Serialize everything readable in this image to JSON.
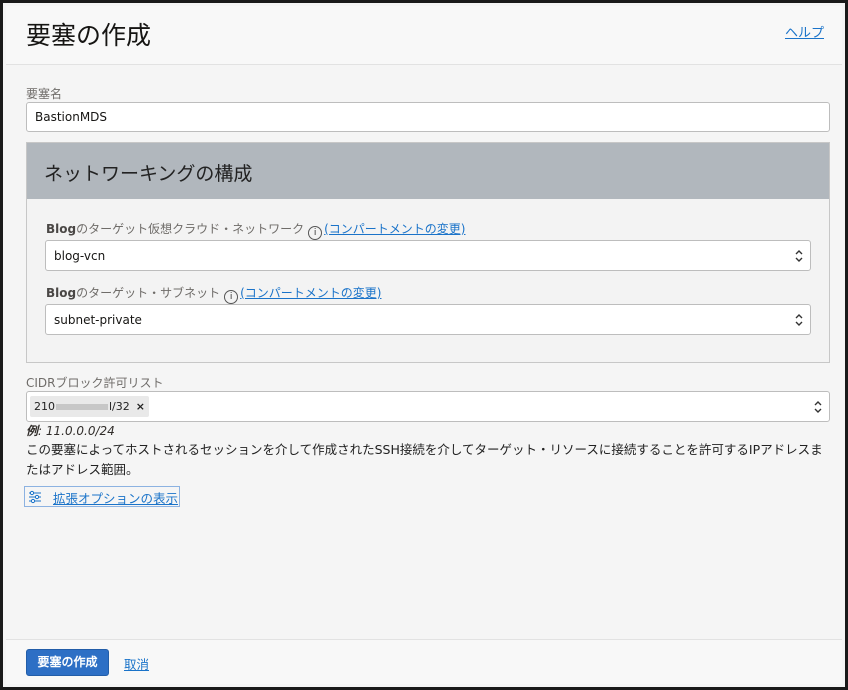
{
  "header": {
    "title": "要塞の作成",
    "help_link": "ヘルプ"
  },
  "bastion_name": {
    "label": "要塞名",
    "value": "BastionMDS"
  },
  "networking": {
    "title": "ネットワーキングの構成",
    "vcn": {
      "label_prefix": "Blog",
      "label_suffix": "のターゲット仮想クラウド・ネットワーク",
      "change_compartment": "(コンパートメントの変更)",
      "value": "blog-vcn"
    },
    "subnet": {
      "label_prefix": "Blog",
      "label_suffix": "のターゲット・サブネット",
      "change_compartment": "(コンパートメントの変更)",
      "value": "subnet-private"
    }
  },
  "cidr": {
    "label": "CIDRブロック許可リスト",
    "chip_start": "210",
    "chip_end": "l/32",
    "chip_remove": "×",
    "example_label": "例",
    "example_value": ": 11.0.0.0/24",
    "description": "この要塞によってホストされるセッションを介して作成されたSSH接続を介してターゲット・リソースに接続することを許可するIPアドレスまたはアドレス範囲。"
  },
  "advanced_options": {
    "label": "拡張オプションの表示"
  },
  "footer": {
    "create_button": "要塞の作成",
    "cancel_link": "取消"
  },
  "icons": {
    "info": "info-icon",
    "select": "updown-icon",
    "sliders": "sliders-icon"
  },
  "colors": {
    "accent": "#2d6fc5",
    "link": "#1a73c9",
    "panel_header": "#b1b7bd"
  }
}
